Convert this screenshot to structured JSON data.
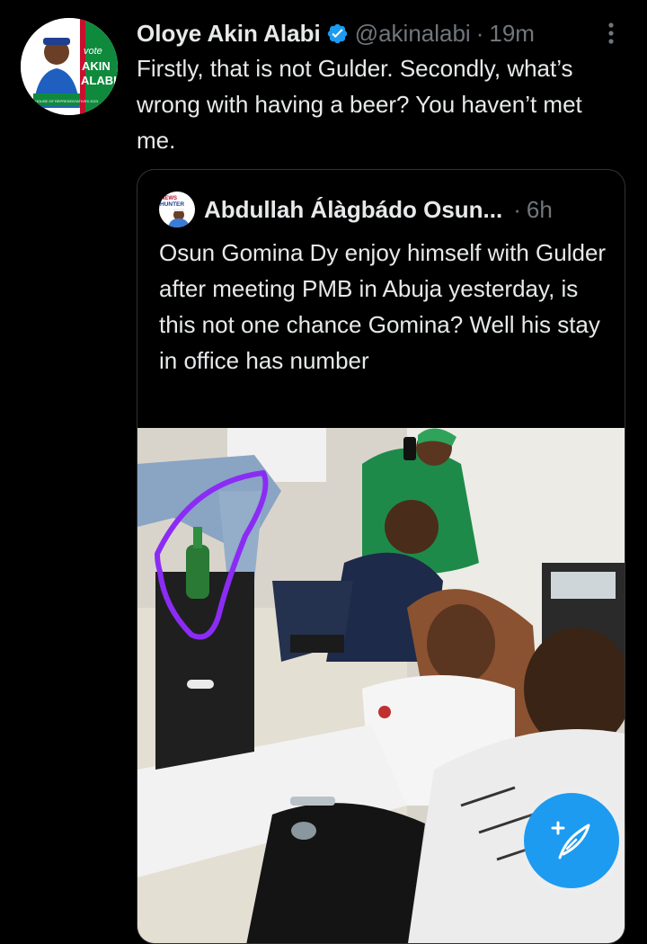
{
  "tweet": {
    "author": {
      "display_name": "Oloye Akin Alabi",
      "handle": "@akinalabi",
      "verified": true,
      "avatar_text": {
        "line1": "vote",
        "line2": "AKIN",
        "line3": "ALABI",
        "line4": "HOUSE OF REPRESENTATIVES 2023"
      }
    },
    "separator": "·",
    "time": "19m",
    "text": "Firstly, that is not Gulder. Secondly, what’s wrong with having a beer? You haven’t met me."
  },
  "quoted_tweet": {
    "author": {
      "display_name": "Abdullah Álàgbádo Osun...",
      "avatar_text": "HUNTER"
    },
    "separator": "·",
    "time": "6h",
    "text": "Osun Gomina Dy enjoy himself with Gulder after meeting PMB in Abuja yesterday, is this not one chance Gomina? Well his stay in office has number",
    "image": {
      "description": "photo-of-people-seated-in-a-room-with-a-green-bottle-circled-in-purple",
      "annotation_color": "#8b2cf5"
    }
  },
  "actions": {
    "compose_icon": "feather-plus-icon",
    "more_icon": "vertical-ellipsis-icon",
    "verified_icon": "verified-check-icon"
  },
  "colors": {
    "background": "#000000",
    "text_primary": "#e7e9ea",
    "text_secondary": "#71767b",
    "accent": "#1d9bf0",
    "border": "#2f3336"
  }
}
